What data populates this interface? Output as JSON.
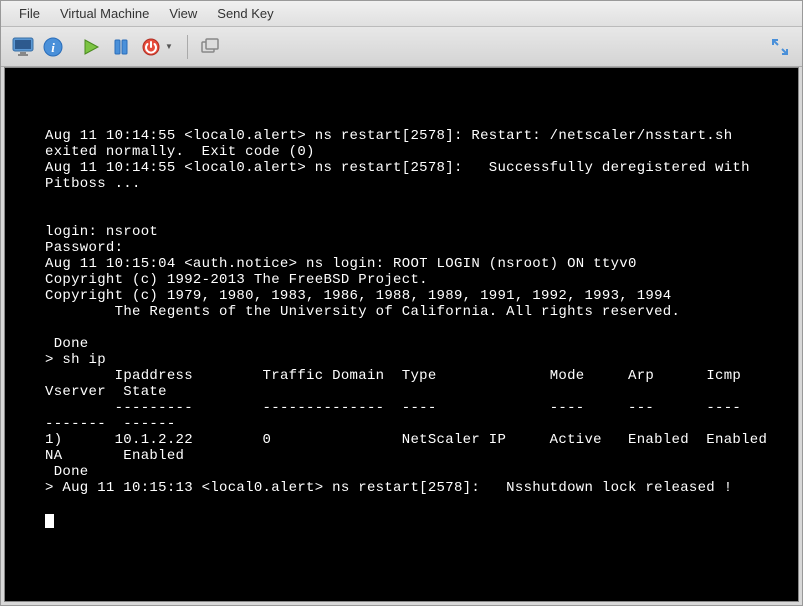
{
  "menu": {
    "items": [
      "File",
      "Virtual Machine",
      "View",
      "Send Key"
    ]
  },
  "toolbar": {
    "monitor_icon": "monitor-icon",
    "info_icon": "info-icon",
    "play_icon": "play-icon",
    "pause_icon": "pause-icon",
    "power_icon": "power-icon",
    "snapshot_icon": "snapshot-icon",
    "fullscreen_icon": "fullscreen-icon"
  },
  "console_lines": [
    "",
    "",
    "",
    "Aug 11 10:14:55 <local0.alert> ns restart[2578]: Restart: /netscaler/nsstart.sh exited normally.  Exit code (0)",
    "Aug 11 10:14:55 <local0.alert> ns restart[2578]:   Successfully deregistered with Pitboss ...",
    "",
    "",
    "login: nsroot",
    "Password:",
    "Aug 11 10:15:04 <auth.notice> ns login: ROOT LOGIN (nsroot) ON ttyv0",
    "Copyright (c) 1992-2013 The FreeBSD Project.",
    "Copyright (c) 1979, 1980, 1983, 1986, 1988, 1989, 1991, 1992, 1993, 1994",
    "        The Regents of the University of California. All rights reserved.",
    "",
    " Done",
    "> sh ip",
    "        Ipaddress        Traffic Domain  Type             Mode     Arp      Icmp     Vserver  State",
    "        ---------        --------------  ----             ----     ---      ----     -------  ------",
    "1)      10.1.2.22        0               NetScaler IP     Active   Enabled  Enabled  NA       Enabled",
    " Done",
    "> Aug 11 10:15:13 <local0.alert> ns restart[2578]:   Nsshutdown lock released !",
    ""
  ]
}
